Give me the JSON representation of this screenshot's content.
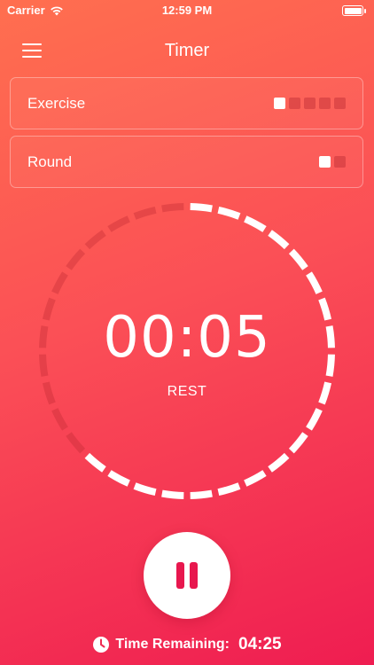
{
  "status_bar": {
    "carrier": "Carrier",
    "time": "12:59 PM"
  },
  "nav": {
    "title": "Timer",
    "menu_icon": "hamburger-menu-icon"
  },
  "settings": [
    {
      "label": "Exercise",
      "total": 5,
      "active": 1
    },
    {
      "label": "Round",
      "total": 2,
      "active": 1
    }
  ],
  "timer": {
    "display": "00:05",
    "phase": "REST",
    "segments_total": 32,
    "segments_completed": 12,
    "completed_color": "#ffffff",
    "pending_color": "rgba(190, 40, 50, 0.35)"
  },
  "controls": {
    "pause_icon": "pause-icon"
  },
  "footer": {
    "icon": "clock-icon",
    "label": "Time Remaining:",
    "value": "04:25"
  },
  "colors": {
    "gradient_start": "#ff6f4f",
    "gradient_end": "#ef1d51",
    "accent": "#e8174e"
  }
}
